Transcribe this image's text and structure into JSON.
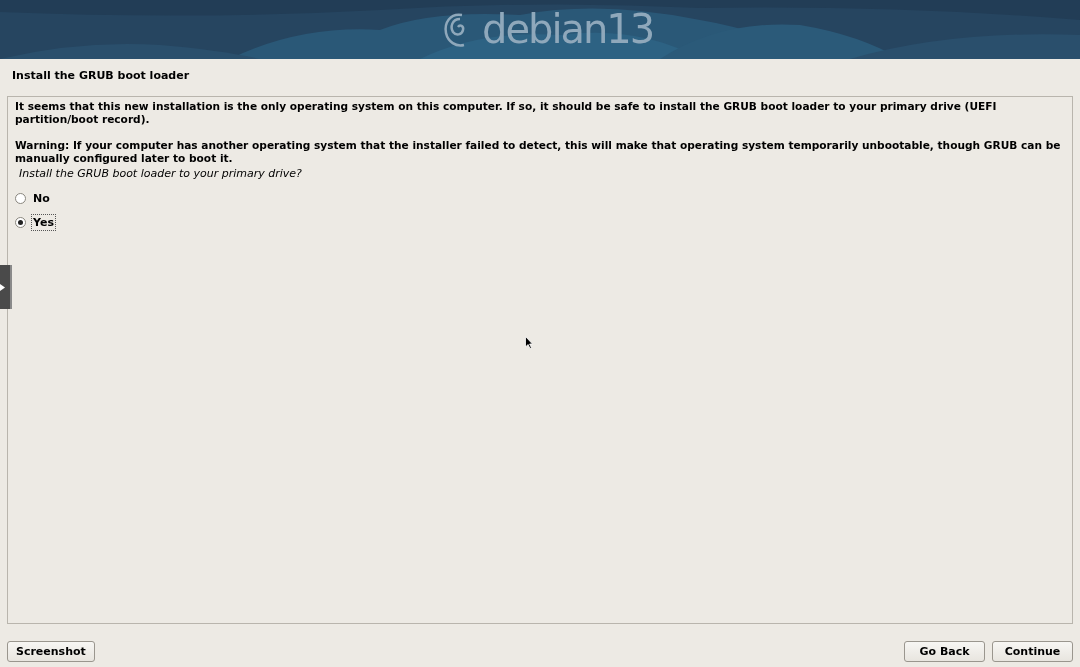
{
  "banner": {
    "kind": "picture",
    "logo_text": "debian13"
  },
  "page_title": "Install the GRUB boot loader",
  "paragraphs": [
    "It seems that this new installation is the only operating system on this computer. If so, it should be safe to install the GRUB boot loader to your primary drive (UEFI partition/boot record).",
    "Warning: If your computer has another operating system that the installer failed to detect, this will make that operating system temporarily unbootable, though GRUB can be manually configured later to boot it."
  ],
  "question": "Install the GRUB boot loader to your primary drive?",
  "options": [
    {
      "label": "No",
      "selected": false
    },
    {
      "label": "Yes",
      "selected": true
    }
  ],
  "buttons_left": [
    "Screenshot"
  ],
  "buttons_right": [
    "Go Back",
    "Continue"
  ]
}
